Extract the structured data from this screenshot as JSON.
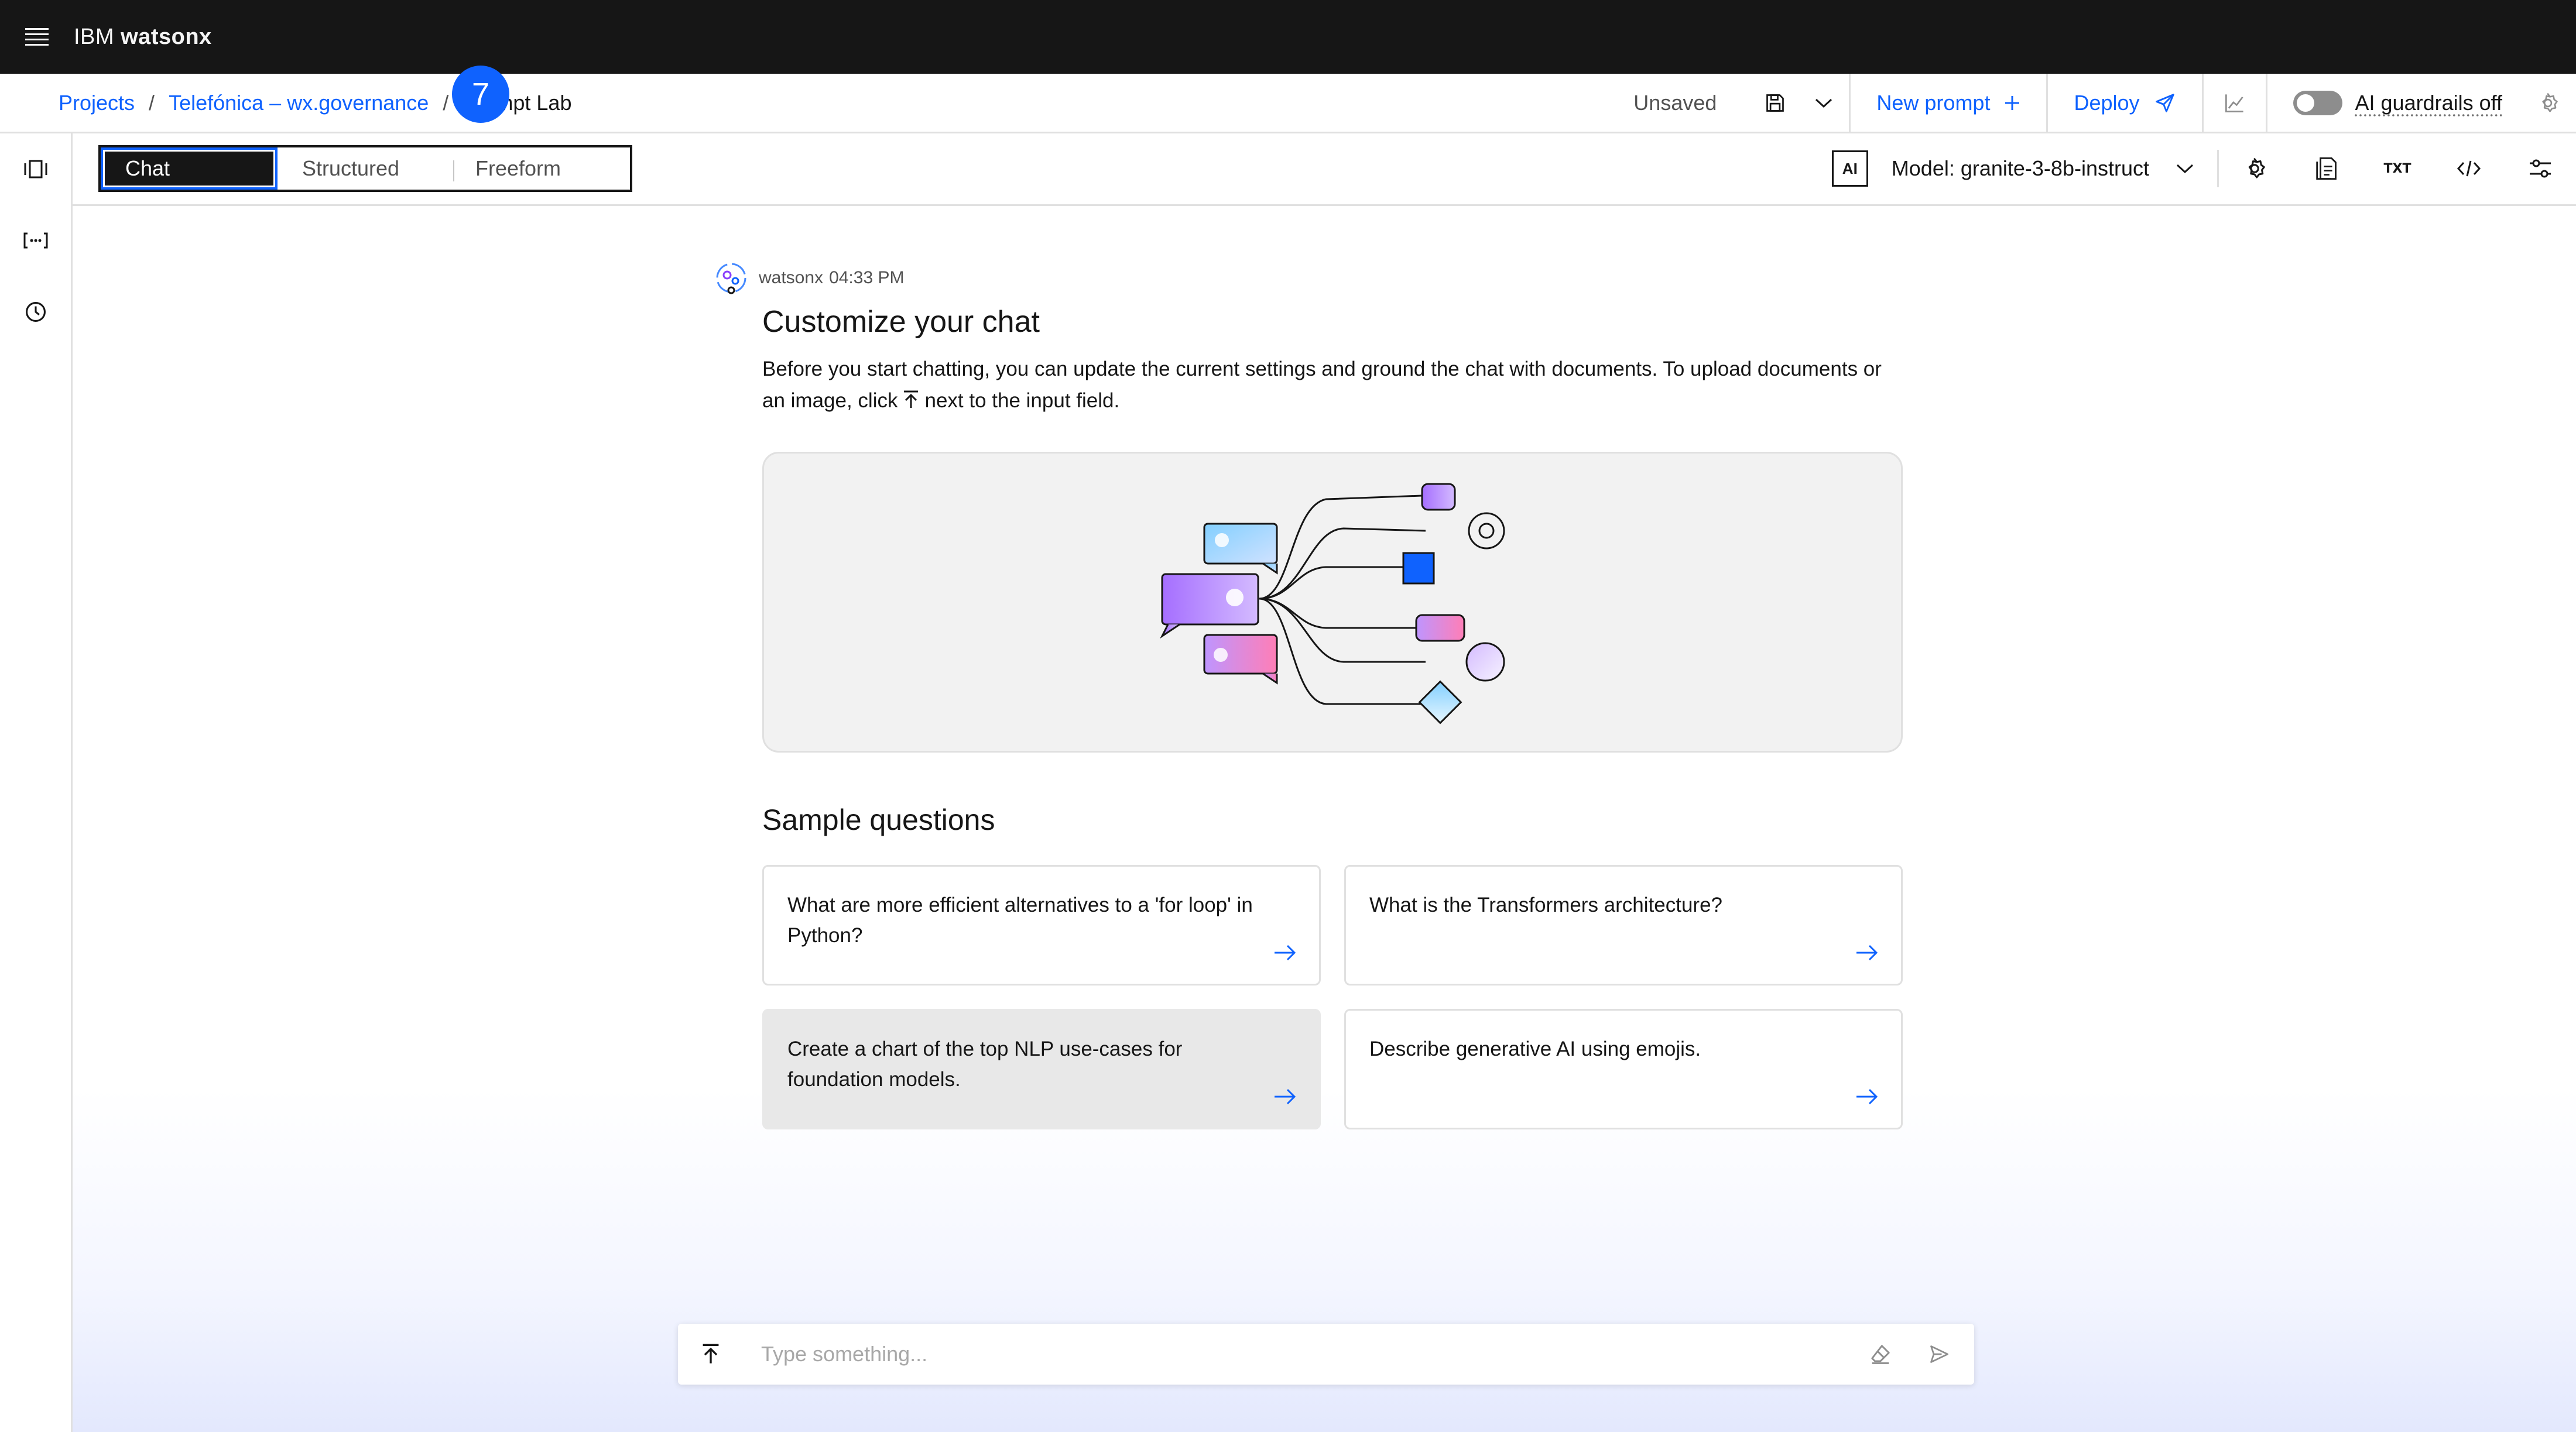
{
  "header": {
    "brand_prefix": "IBM",
    "brand_product": "watsonx"
  },
  "breadcrumb": {
    "items": [
      "Projects",
      "Telefónica – wx.governance"
    ],
    "separator": "/",
    "current": "Prompt Lab"
  },
  "actions": {
    "status": "Unsaved",
    "new_prompt": "New prompt",
    "deploy": "Deploy",
    "guardrails_label": "AI guardrails off",
    "guardrails_on": false
  },
  "mode_switcher": {
    "tabs": [
      "Chat",
      "Structured",
      "Freeform"
    ],
    "selected": "Chat"
  },
  "step_badge": "7",
  "model": {
    "ai_badge": "AI",
    "label": "Model: granite-3-8b-instruct",
    "txt_icon": "TXT"
  },
  "message": {
    "author": "watsonx",
    "time": "04:33 PM",
    "title": "Customize your chat",
    "body_part1": "Before you start chatting, you can update the current settings and ground the chat with documents. To upload documents or an image, click",
    "body_part2": "next to the input field."
  },
  "samples": {
    "title": "Sample questions",
    "questions": [
      "What are more efficient alternatives to a 'for loop' in Python?",
      "What is the Transformers architecture?",
      "Create a chart of the top NLP use-cases for foundation models.",
      "Describe generative AI using emojis."
    ]
  },
  "input": {
    "placeholder": "Type something...",
    "value": ""
  },
  "colors": {
    "header_bg": "#161616",
    "link": "#0f62fe",
    "badge": "#0f62fe",
    "card_hover": "#e8e8e8",
    "illustration_bg": "#f2f2f2"
  },
  "icons": {
    "menu": "hamburger-menu-icon",
    "save": "save-icon",
    "chevron": "chevron-down-icon",
    "add": "add-icon",
    "deploy": "send-plane-icon",
    "chart": "chart-line-icon",
    "settings": "settings-icon",
    "rail": [
      "carousel-icon",
      "variables-brackets-icon",
      "history-clock-icon"
    ],
    "toolbar": [
      "model-parameters-icon",
      "document-icon",
      "txt-icon",
      "code-icon",
      "sliders-icon"
    ],
    "arrow": "arrow-right-icon",
    "upload": "upload-icon",
    "clear": "eraser-icon",
    "send": "send-icon"
  }
}
